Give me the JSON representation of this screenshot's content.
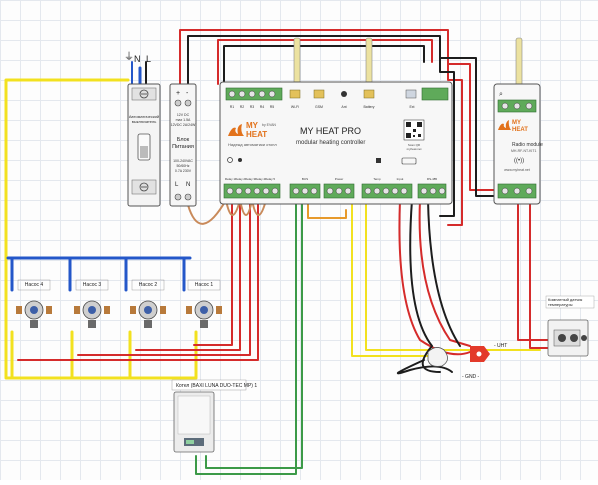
{
  "breaker": {
    "supply_n": "N",
    "supply_l": "L",
    "label_line1": "Автоматический",
    "label_line2": "выключатель"
  },
  "psu": {
    "plus": "+",
    "minus": "-",
    "spec_top_1": "12V DC",
    "spec_top_2": "max 1.5A",
    "spec_top_3": "12VDC 2A/24W",
    "title_line1": "Блок",
    "title_line2": "Питания",
    "spec_bottom_1": "100-240VAC",
    "spec_bottom_2": "50/60Hz",
    "spec_bottom_3": "0.7A 230V",
    "term_l": "L",
    "term_n": "N"
  },
  "controller": {
    "brand_my": "MY",
    "brand_heat": "HEAT",
    "brand_by": "by EVAN",
    "tagline": "Надежд автоматики отопл",
    "model": "MY HEAT PRO",
    "subtitle": "modular heating controller",
    "qr_caption_1": "Scan QR",
    "qr_caption_2": "myheat.net",
    "top_labels": [
      "R1",
      "R2",
      "R3",
      "R4",
      "R5"
    ],
    "top_labels_right": [
      "Wi-Fi",
      "GSM",
      "Ant",
      "Battery",
      "Ext"
    ],
    "bottom_labels": [
      "Relay 1",
      "Relay 2",
      "Relay 3",
      "Relay 4",
      "Relay 5",
      "Relay 6"
    ],
    "bottom_labels_right": [
      "BUS",
      "Power",
      "Temp",
      "Input",
      "RS-485"
    ]
  },
  "radio_module": {
    "brand_my": "MY",
    "brand_heat": "HEAT",
    "title": "Radio module",
    "model": "MH-RF-NT-KIT1",
    "site": "www.myheat.net"
  },
  "pumps": [
    {
      "label": "Насос 4"
    },
    {
      "label": "Насос 3"
    },
    {
      "label": "Насос 2"
    },
    {
      "label": "Насос 1"
    }
  ],
  "boiler": {
    "label": "Котел (BAXI LUNA DUO-TEC MP) 1"
  },
  "sensors": {
    "wireless_sensor_label_1": "Комнатный датчик",
    "wireless_sensor_label_2": "температуры",
    "tank_sensor_label": "- UHT",
    "gnd_label": "- GND -"
  },
  "colors": {
    "red_wire": "#d52b2b",
    "black_wire": "#1d1d1d",
    "green_wire": "#3c9a48",
    "yellow_wire": "#f2e11f",
    "blue_wire": "#2457c9",
    "brown_wire": "#c98a5a",
    "terminal_green": "#5faa5a",
    "antenna_yellow": "#ece2a0"
  }
}
